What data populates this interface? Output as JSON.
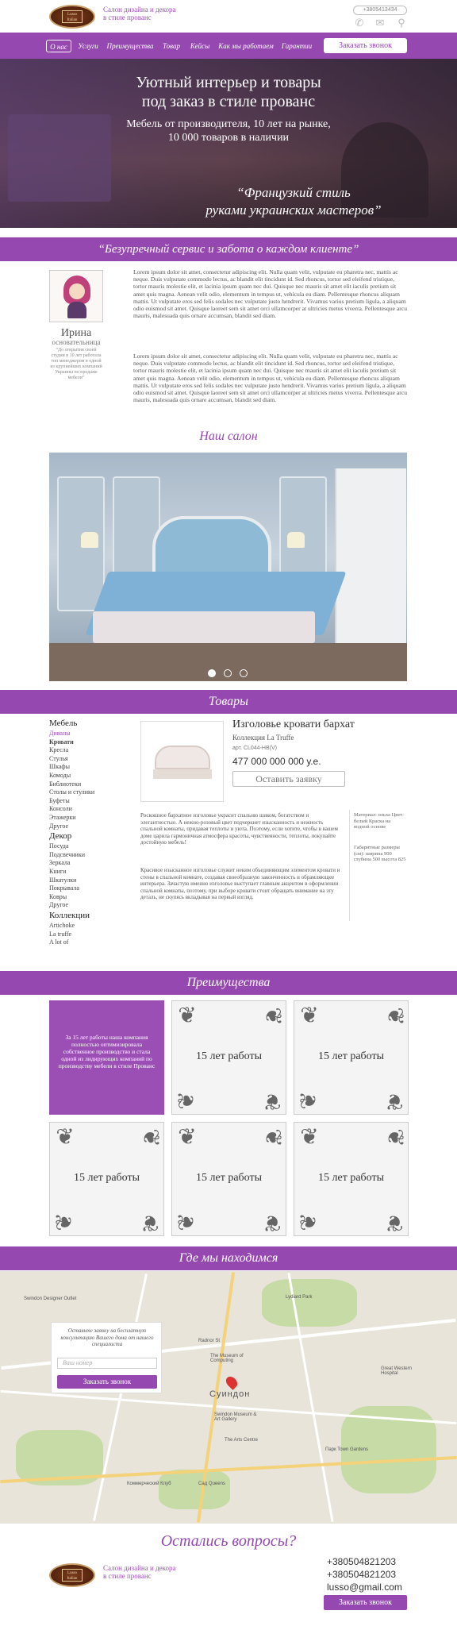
{
  "header": {
    "logo_text": "Lusso Italian",
    "tagline": [
      "Салон дизайна и декора",
      "в стиле прованс"
    ],
    "phone": "+3805413434",
    "icons": [
      "phone-icon",
      "mail-icon",
      "location-icon"
    ]
  },
  "nav": {
    "items": [
      "О нас",
      "Услуги",
      "Преимущества",
      "Товар",
      "Кейсы",
      "Как мы работаем",
      "Гарантии"
    ],
    "active_index": 0,
    "call_button": "Заказать звонок"
  },
  "hero": {
    "title_line1": "Уютный интерьер и товары",
    "title_line2": "под заказ в стиле прованс",
    "sub_line1": "Мебель от производителя, 10 лет на рынке,",
    "sub_line2": "10 000 товаров в наличии",
    "slogan_line1": "“Французкий стиль",
    "slogan_line2": "руками украинских мастеров”"
  },
  "service_band": "“Безупречный сервис и забота о каждом клиенте”",
  "about": {
    "name": "Ирина",
    "role": "основательница",
    "quote": "“До открытия своей студии в 10 лет работала топ менеджером в одной из крупнейших компаний Украины по продаже мебели”",
    "paragraph1": "Lorem ipsum dolor sit amet, consectetur adipiscing elit. Nulla quam velit, vulputate eu pharetra nec, mattis ac neque. Duis vulputate commodo lectus, ac blandit elit tincidunt id. Sed rhoncus, tortor sed eleifend tristique, tortor mauris molestie elit, et lacinia ipsum quam nec dui. Quisque nec mauris sit amet elit iaculis pretium sit amet quis magna. Aenean velit odio, elementum in tempus ut, vehicula eu diam. Pellentesque rhoncus aliquam mattis. Ut vulputate eros sed felis sodales nec vulputate justo hendrerit. Vivamus varius pretium ligula, a aliquam odio euismod sit amet. Quisque laoreet sem sit amet orci ullamcorper at ultricies metus viverra. Pellentesque arcu mauris, malesuada quis ornare accumsan, blandit sed diam.",
    "paragraph2": "Lorem ipsum dolor sit amet, consectetur adipiscing elit. Nulla quam velit, vulputate eu pharetra nec, mattis ac neque. Duis vulputate commodo lectus, ac blandit elit tincidunt id. Sed rhoncus, tortor sed eleifend tristique, tortor mauris molestie elit, et lacinia ipsum quam nec dui. Quisque nec mauris sit amet elit iaculis pretium sit amet quis magna. Aenean velit odio, elementum in tempus ut, vehicula eu diam. Pellentesque rhoncus aliquam mattis. Ut vulputate eros sed felis sodales nec vulputate justo hendrerit. Vivamus varius pretium ligula, a aliquam odio euismod sit amet. Quisque laoreet sem sit amet orci ullamcorper at ultricies metus viverra. Pellentesque arcu mauris, malesuada quis ornare accumsan, blandit sed diam."
  },
  "salon": {
    "title": "Наш салон",
    "slides": 3,
    "active_slide": 0
  },
  "products": {
    "band_title": "Товары",
    "categories": [
      {
        "label": "Мебель",
        "kind": "h"
      },
      {
        "label": "Диваны",
        "kind": "sel"
      },
      {
        "label": "Кровати",
        "kind": "b"
      },
      {
        "label": "Кресла",
        "kind": ""
      },
      {
        "label": "Стулья",
        "kind": ""
      },
      {
        "label": "Шкафы",
        "kind": ""
      },
      {
        "label": "Комоды",
        "kind": ""
      },
      {
        "label": "Библиотеки",
        "kind": ""
      },
      {
        "label": "Столы и стулики",
        "kind": ""
      },
      {
        "label": "Буфеты",
        "kind": ""
      },
      {
        "label": "Консоли",
        "kind": ""
      },
      {
        "label": "Этажерки",
        "kind": ""
      },
      {
        "label": "Другое",
        "kind": ""
      },
      {
        "label": "Декор",
        "kind": "h"
      },
      {
        "label": "Посуда",
        "kind": ""
      },
      {
        "label": "Подсвечники",
        "kind": ""
      },
      {
        "label": "Зеркала",
        "kind": ""
      },
      {
        "label": "Книги",
        "kind": ""
      },
      {
        "label": "Шкатулки",
        "kind": ""
      },
      {
        "label": "Покрывала",
        "kind": ""
      },
      {
        "label": "Ковры",
        "kind": ""
      },
      {
        "label": "Другое",
        "kind": ""
      },
      {
        "label": "Коллекции",
        "kind": "h"
      },
      {
        "label": "Artichoke",
        "kind": ""
      },
      {
        "label": "La truffe",
        "kind": ""
      },
      {
        "label": "A lot of",
        "kind": ""
      }
    ],
    "item": {
      "title": "Изголовье кровати бархат",
      "collection": "Коллекция La Truffe",
      "article": "арт. CL044-HB(V)",
      "price": "477 000 000 000 у.е.",
      "order_button": "Оставить заявку",
      "desc1": "Роскошное бархатное изголовье украсит спальню шиком, богатством и элегантностью. А нежно-розовый цвет подчеркнет изысканность и нежность спальной комнаты, придавая теплоты и уюта. Поэтому, если хотите, чтобы в вашем доме царила гармоничная атмосфера красоты, чувственности, теплоты, покупайте достойную мебель!",
      "desc2": "Красивое изысканное изголовье служит неким объединяющим элементом кровати и стены в спальной комнате, создавая своеобразную законченность и обрамляющее интерьера. Зачастую именно изголовье выступает главным акцентом в оформлении спальной комнаты, поэтому, при выборе кровати стоит обращать внимание на эту деталь, не скупясь вкладывая на первый взгляд.",
      "spec1": "Материал: ольха Цвет: белый Краска на водной основе",
      "spec2": "Габаритные размеры (см): ширина 900 глубина 500 высота 825"
    }
  },
  "advantages": {
    "band_title": "Преимущества",
    "intro": "За 15 лет работы наша компания полностью оптимизировала собственное производство и стала одной из лидирующих компаний по производству мебели в стиле Прованс",
    "cards": [
      "15 лет работы",
      "15 лет работы",
      "15 лет работы",
      "15 лет работы",
      "15 лет работы"
    ]
  },
  "location": {
    "band_title": "Где мы находимся",
    "form_text": "Оставьте заявку на бесплатную консультацию Вашего дома от нашего специалиста",
    "phone_placeholder": "Ваш номер",
    "button": "Заказать звонок",
    "city": "Суиндон",
    "map_labels": [
      "Swindon Designer Outlet",
      "Radnor St",
      "The Museum of Computing",
      "Swindon Museum & Art Gallery",
      "The Arts Centre",
      "Great Western Hospital",
      "Коммерческий Клуб",
      "Сад Queens",
      "Парк Town Gardens",
      "Lydiard Park"
    ]
  },
  "footer": {
    "title": "Остались вопросы?",
    "tagline": [
      "Салон дизайна и декора",
      "в стиле прованс"
    ],
    "phone1": "+380504821203",
    "phone2": "+380504821203",
    "email": "lusso@gmail.com",
    "button": "Заказать звонок"
  },
  "colors": {
    "accent": "#9448b0",
    "accent_light": "#9b4fb5"
  }
}
